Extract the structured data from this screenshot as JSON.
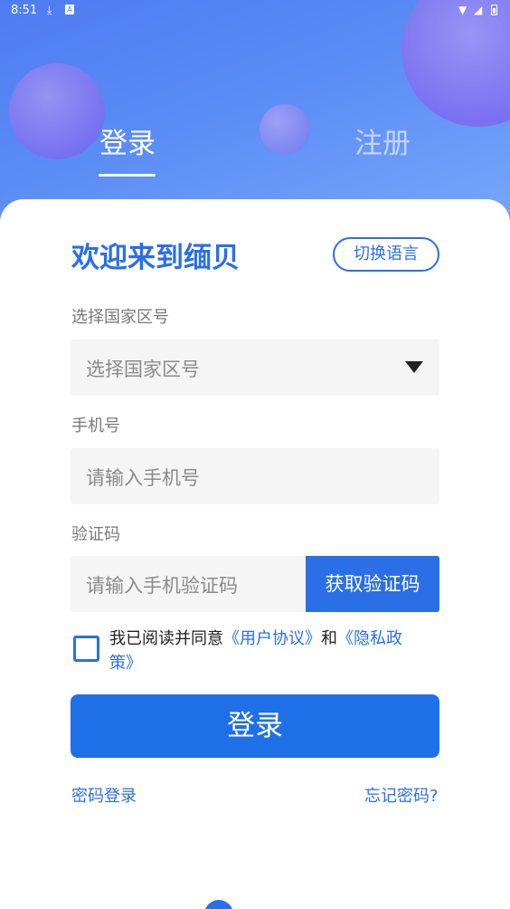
{
  "status_bar": {
    "time": "8:51",
    "download_icon": "download-icon",
    "a_badge": "A",
    "wifi_icon": "wifi-icon",
    "signal_icon": "signal-icon",
    "battery_icon": "battery-icon"
  },
  "tabs": {
    "login": "登录",
    "register": "注册"
  },
  "welcome": "欢迎来到缅贝",
  "switch_language": "切换语言",
  "country": {
    "label": "选择国家区号",
    "placeholder": "选择国家区号"
  },
  "phone": {
    "label": "手机号",
    "placeholder": "请输入手机号"
  },
  "code": {
    "label": "验证码",
    "placeholder": "请输入手机验证码",
    "button": "获取验证码"
  },
  "agreement": {
    "prefix": "我已阅读并同意",
    "user_agreement": "《用户协议》",
    "and": "和",
    "privacy_policy": "《隐私政策》"
  },
  "login_button": "登录",
  "password_login": "密码登录",
  "forgot_password": "忘记密码?",
  "colors": {
    "primary": "#2a6fe6",
    "header_gradient_start": "#4f7cf2",
    "header_gradient_end": "#78a8fb"
  }
}
